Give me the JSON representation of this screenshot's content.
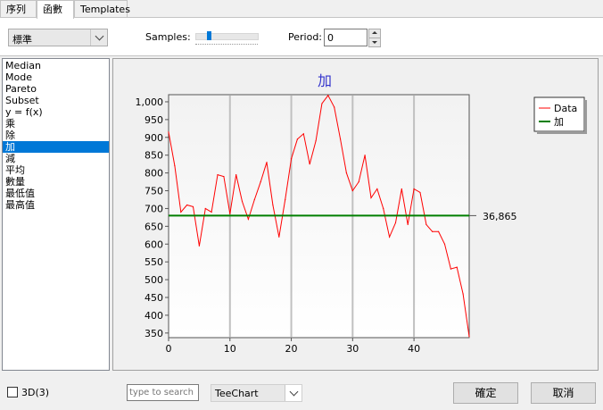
{
  "tabs": [
    "序列",
    "函數",
    "Templates"
  ],
  "active_tab": 1,
  "options": {
    "style_value": "標準",
    "samples_label": "Samples:",
    "period_label": "Period:",
    "period_value": "0"
  },
  "functions": [
    "Median",
    "Mode",
    "Pareto",
    "Subset",
    "y = f(x)",
    "乘",
    "除",
    "加",
    "減",
    "平均",
    "數量",
    "最低值",
    "最高值"
  ],
  "selected_function": 7,
  "footer": {
    "checkbox_3d_label": "3D(3)",
    "search_placeholder": "type to search",
    "theme_value": "TeeChart",
    "ok_label": "確定",
    "cancel_label": "取消"
  },
  "colors": {
    "data_series": "#ff0000",
    "function_series": "#007f00",
    "title": "#3333cc",
    "selection": "#0078d7"
  },
  "chart_data": {
    "type": "line",
    "title": "加",
    "xlabel": "",
    "ylabel": "",
    "xlim": [
      0,
      49
    ],
    "ylim": [
      337,
      1020
    ],
    "x_ticks": [
      "0",
      "10",
      "20",
      "30",
      "40"
    ],
    "y_ticks": [
      "350",
      "400",
      "450",
      "500",
      "550",
      "600",
      "650",
      "700",
      "750",
      "800",
      "850",
      "900",
      "950",
      "1,000"
    ],
    "legend_position": "top-right",
    "series": [
      {
        "name": "Data",
        "x": [
          0,
          1,
          2,
          3,
          4,
          5,
          6,
          7,
          8,
          9,
          10,
          11,
          12,
          13,
          14,
          15,
          16,
          17,
          18,
          19,
          20,
          21,
          22,
          23,
          24,
          25,
          26,
          27,
          28,
          29,
          30,
          31,
          32,
          33,
          34,
          35,
          36,
          37,
          38,
          39,
          40,
          41,
          42,
          43,
          44,
          45,
          46,
          47,
          48,
          49
        ],
        "values": [
          915,
          820,
          690,
          710,
          705,
          595,
          700,
          690,
          795,
          790,
          685,
          795,
          720,
          670,
          725,
          775,
          830,
          710,
          620,
          725,
          840,
          895,
          910,
          825,
          890,
          995,
          1018,
          985,
          895,
          800,
          750,
          775,
          850,
          730,
          755,
          700,
          620,
          660,
          755,
          655,
          755,
          745,
          655,
          635,
          635,
          600,
          530,
          535,
          460,
          340
        ]
      },
      {
        "name": "加",
        "x": [
          0,
          49
        ],
        "values": [
          680,
          680
        ],
        "label": "36,865"
      }
    ]
  }
}
